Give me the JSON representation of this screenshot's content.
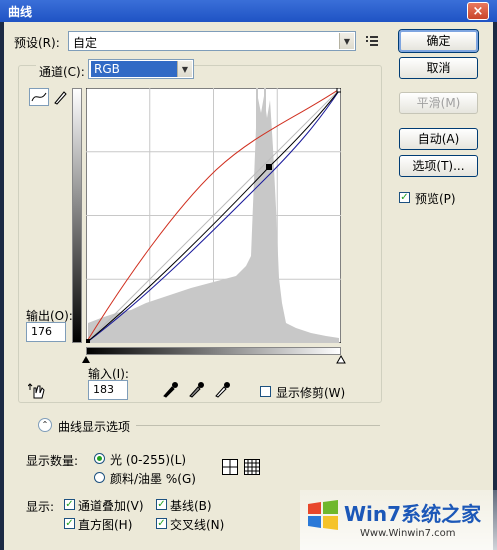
{
  "window": {
    "title": "曲线",
    "close_glyph": "×"
  },
  "preset": {
    "label": "预设(R):",
    "value": "自定"
  },
  "channel": {
    "label": "通道(C):",
    "value": "RGB"
  },
  "buttons": {
    "ok": "确定",
    "cancel": "取消",
    "smooth": "平滑(M)",
    "auto": "自动(A)",
    "options": "选项(T)..."
  },
  "preview": {
    "label": "预览(P)",
    "checked": true
  },
  "output": {
    "label": "输出(O):",
    "value": "176"
  },
  "input": {
    "label": "输入(I):",
    "value": "183"
  },
  "show_clipping": {
    "label": "显示修剪(W)",
    "checked": false
  },
  "display_options": {
    "label": "曲线显示选项"
  },
  "show_amount": {
    "label": "显示数量:",
    "light": "光 (0-255)(L)",
    "pigment": "颜料/油墨 %(G)",
    "selected": "light"
  },
  "show": {
    "label": "显示:",
    "channel_overlays": "通道叠加(V)",
    "baseline": "基线(B)",
    "histogram": "直方图(H)",
    "intersection": "交叉线(N)"
  },
  "watermark": {
    "text": "Win7系统之家",
    "url": "Www.Winwin7.com"
  },
  "colors": {
    "titlebar": "#2a5fcf",
    "dialog": "#ece9d8",
    "curve_rgb": "#000000",
    "curve_red": "#d03020",
    "curve_blue": "#1a1a9a",
    "histogram": "#c8c8c8"
  }
}
